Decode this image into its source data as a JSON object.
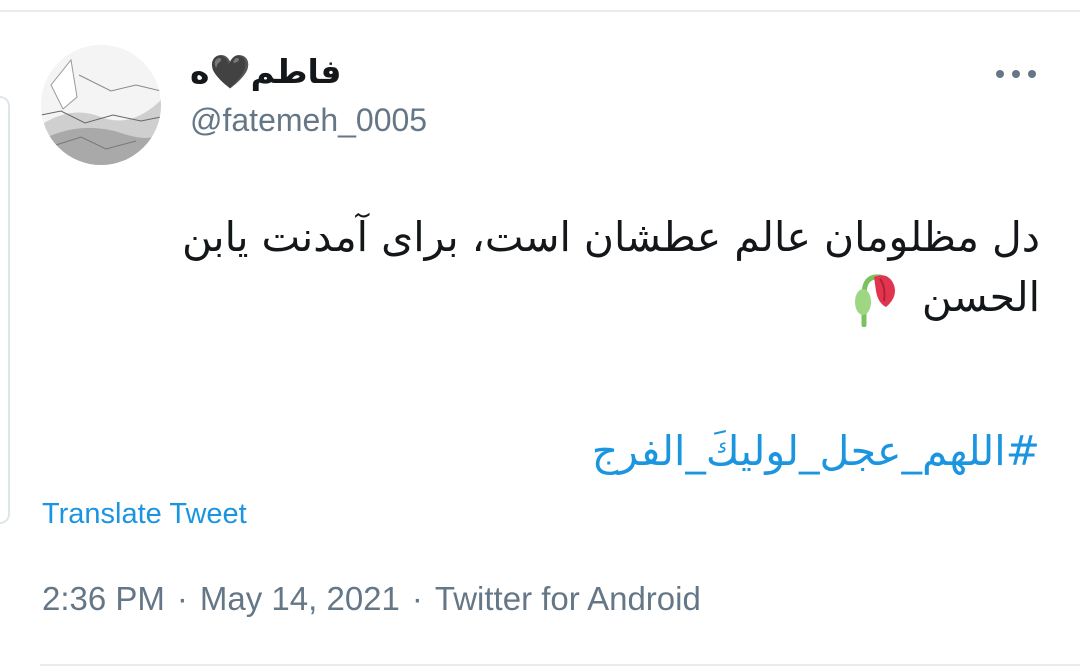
{
  "tweet": {
    "display_name": "فاطم🖤ه",
    "handle": "@fatemeh_0005",
    "text_line1": "دل مظلومان عالم عطشان است، برای آمدنت یابن",
    "text_line2": "الحسن",
    "emoji": "wilted-flower-icon",
    "hashtag": "#اللهم_عجل_لولیكَ_الفرج",
    "translate_label": "Translate Tweet",
    "time": "2:36 PM",
    "date": "May 14, 2021",
    "source": "Twitter for Android",
    "separator": "·"
  },
  "colors": {
    "link": "#1b95e0",
    "text": "#14171a",
    "muted": "#657786",
    "divider": "#e6ecf0"
  }
}
